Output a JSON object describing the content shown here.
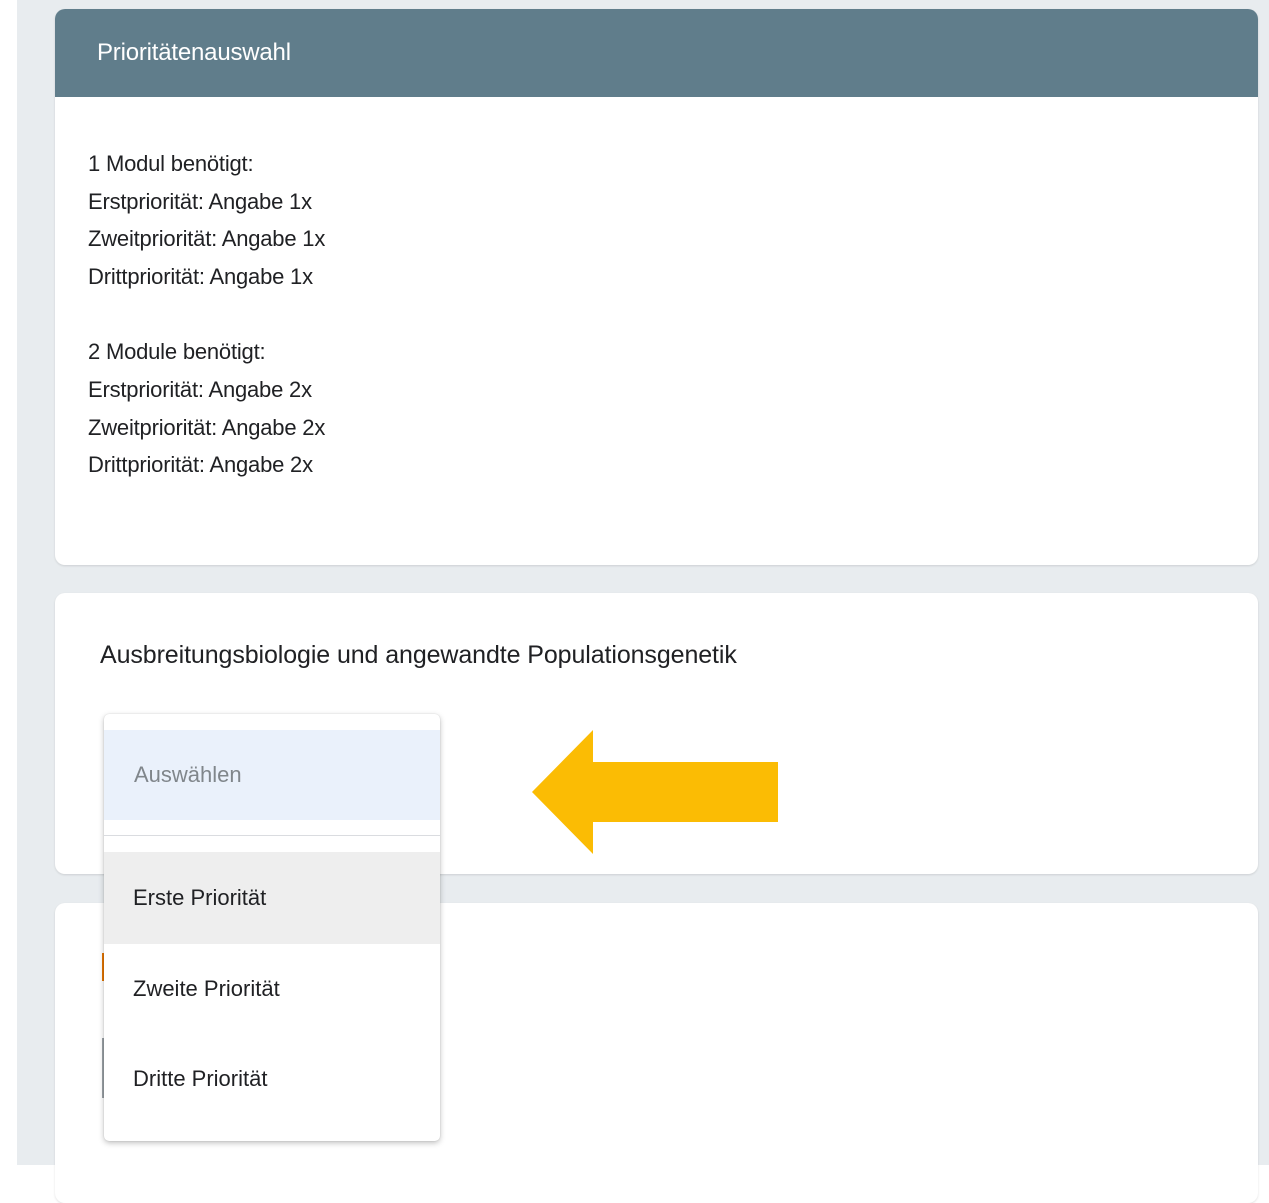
{
  "priority_card": {
    "title": "Prioritätenauswahl",
    "one_module": {
      "heading": "1 Modul benötigt:",
      "first": "Erstpriorität: Angabe 1x",
      "second": "Zweitpriorität: Angabe 1x",
      "third": "Drittpriorität: Angabe 1x"
    },
    "two_modules": {
      "heading": "2 Module benötigt:",
      "first": "Erstpriorität: Angabe 2x",
      "second": "Zweitpriorität: Angabe 2x",
      "third": "Drittpriorität: Angabe 2x"
    }
  },
  "question": {
    "title": "Ausbreitungsbiologie und angewandte Populationsgenetik",
    "dropdown": {
      "placeholder": "Auswählen",
      "options": [
        "Erste Priorität",
        "Zweite Priorität",
        "Dritte Priorität"
      ],
      "hovered_index": 0
    }
  },
  "colors": {
    "header_bg": "#607d8b",
    "page_bg": "#e8ecef",
    "arrow": "#fbbc04",
    "placeholder_bg": "#eaf1fb",
    "hover_bg": "#eeeeee",
    "accent_orange": "#e37400"
  },
  "annotation": {
    "icon": "left-arrow-icon"
  }
}
